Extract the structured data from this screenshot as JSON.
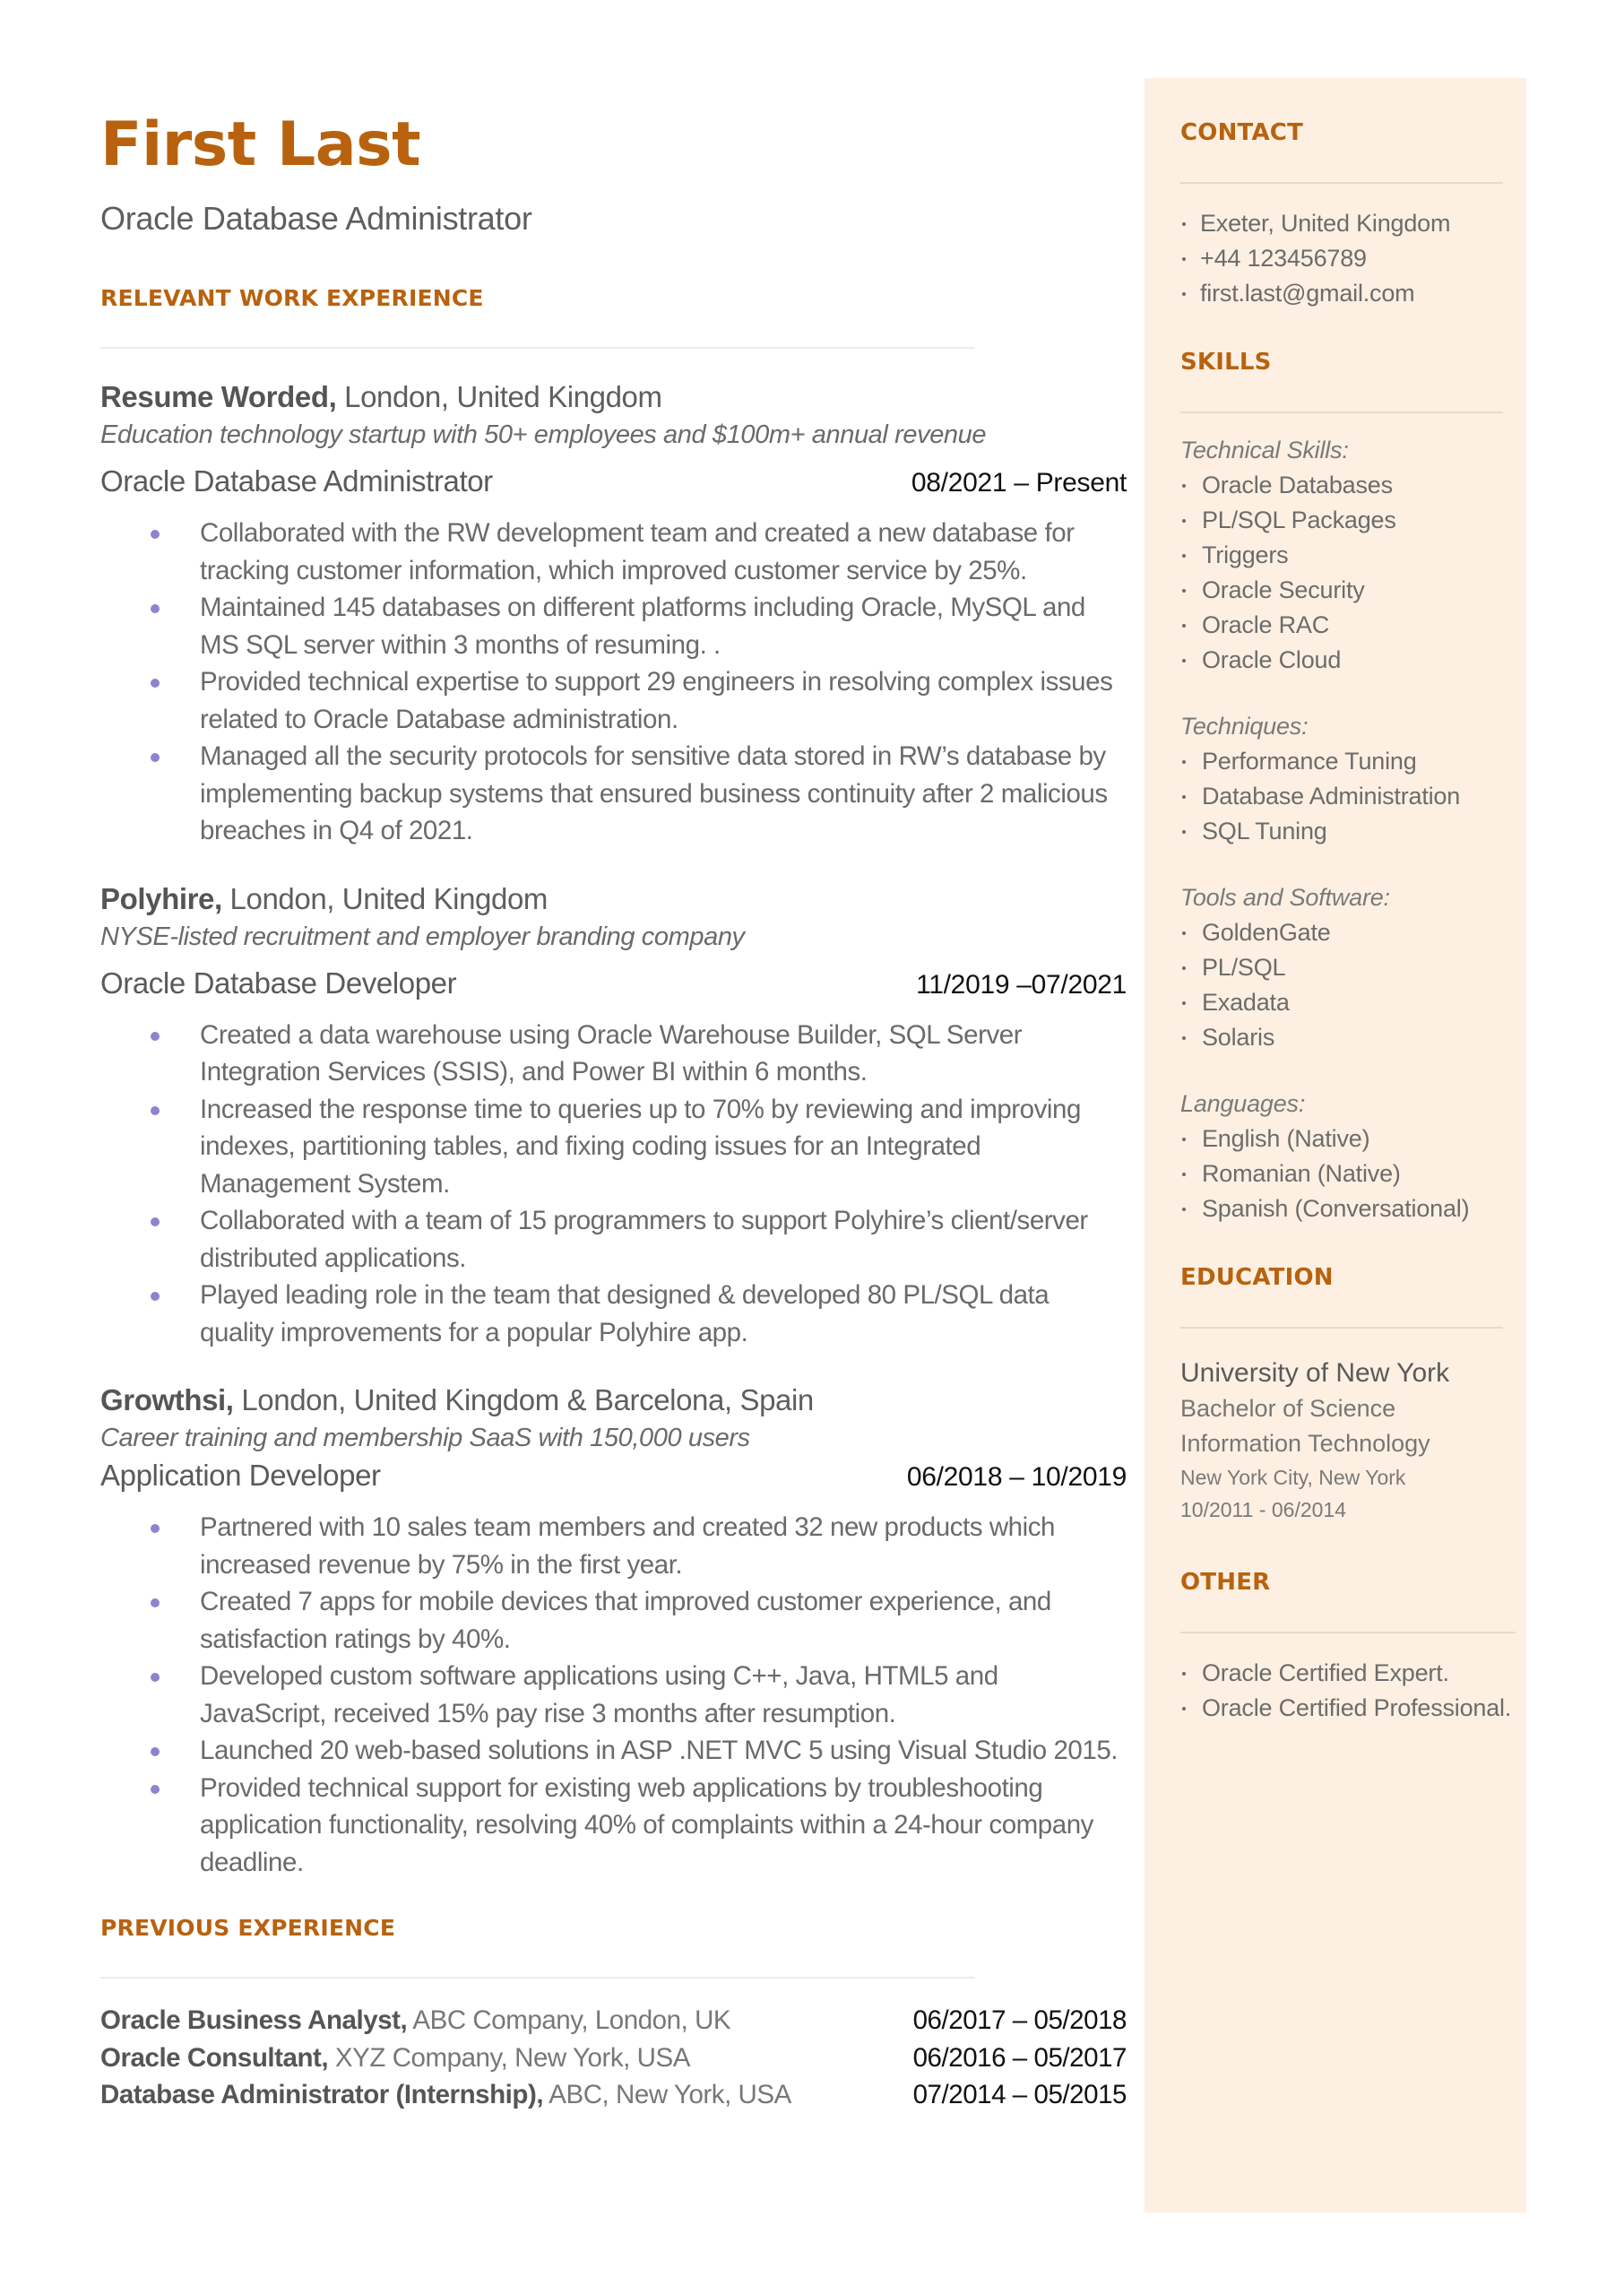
{
  "header": {
    "name": "First Last",
    "title": "Oracle Database Administrator"
  },
  "colors": {
    "accent": "#b8620f",
    "sidebar_bg": "#fdf0e2",
    "bullet": "#8f82cf"
  },
  "work": {
    "heading": "RELEVANT WORK EXPERIENCE",
    "jobs": [
      {
        "company": "Resume Worded,",
        "location": " London, United Kingdom",
        "description": "Education technology startup with 50+ employees and $100m+ annual revenue",
        "role": "Oracle Database Administrator",
        "dates": "08/2021 – Present",
        "bullets": [
          "Collaborated with the RW development team and created a new database for tracking customer information, which improved customer service by 25%.",
          "Maintained 145 databases on different platforms including Oracle, MySQL and MS SQL server within 3 months of resuming. .",
          "Provided technical expertise to support 29 engineers in resolving complex issues related to Oracle Database administration.",
          "Managed all the security protocols for sensitive data stored in RW’s database by implementing backup systems that ensured business continuity after 2 malicious breaches in Q4 of 2021."
        ]
      },
      {
        "company": "Polyhire,",
        "location": " London, United Kingdom",
        "description": "NYSE-listed recruitment and employer branding company",
        "role": "Oracle Database Developer",
        "dates": "11/2019 –07/2021",
        "bullets": [
          "Created a data warehouse using Oracle Warehouse Builder, SQL Server Integration Services (SSIS), and Power BI within 6 months.",
          "Increased the response time to queries up to 70%  by reviewing and improving indexes, partitioning tables, and fixing coding issues for an Integrated Management System.",
          "Collaborated with a team of 15 programmers to support Polyhire’s client/server distributed applications.",
          "Played leading role in the team that designed & developed 80 PL/SQL data quality improvements for a popular Polyhire app."
        ]
      },
      {
        "company": "Growthsi,",
        "location": " London, United Kingdom & Barcelona, Spain",
        "description": "Career training and membership SaaS with 150,000 users",
        "role": "Application Developer",
        "dates": "06/2018 – 10/2019",
        "bullets": [
          "Partnered with 10 sales team members and created 32 new products which increased revenue by 75% in the first year.",
          "Created 7 apps for mobile devices that improved customer experience, and satisfaction ratings by 40%.",
          "Developed custom software applications using C++, Java, HTML5 and JavaScript, received 15% pay rise 3 months after resumption.",
          "Launched 20 web-based solutions in ASP .NET MVC 5 using Visual Studio 2015.",
          "Provided technical support for existing web applications by troubleshooting application functionality, resolving 40% of complaints within a 24-hour company deadline."
        ]
      }
    ]
  },
  "previous": {
    "heading": "PREVIOUS EXPERIENCE",
    "items": [
      {
        "title": "Oracle Business Analyst,",
        "org": " ABC Company, London, UK",
        "dates": "06/2017 – 05/2018"
      },
      {
        "title": "Oracle Consultant,",
        "org": " XYZ Company, New York, USA",
        "dates": "06/2016 – 05/2017"
      },
      {
        "title": "Database Administrator (Internship),",
        "org": " ABC, New York, USA",
        "dates": "07/2014 – 05/2015"
      }
    ]
  },
  "sidebar": {
    "contact": {
      "heading": "CONTACT",
      "items": [
        "Exeter, United Kingdom",
        "+44 123456789",
        "first.last@gmail.com"
      ]
    },
    "skills": {
      "heading": "SKILLS",
      "groups": [
        {
          "label": "Technical Skills:",
          "items": [
            "Oracle Databases",
            "PL/SQL Packages",
            "Triggers",
            "Oracle Security",
            "Oracle RAC",
            "Oracle Cloud"
          ]
        },
        {
          "label": "Techniques:",
          "items": [
            "Performance Tuning",
            "Database Administration",
            "SQL Tuning"
          ]
        },
        {
          "label": "Tools and Software:",
          "items": [
            "GoldenGate",
            "PL/SQL",
            "Exadata",
            "Solaris"
          ]
        },
        {
          "label": "Languages:",
          "items": [
            "English (Native)",
            "Romanian (Native)",
            "Spanish (Conversational)"
          ]
        }
      ]
    },
    "education": {
      "heading": "EDUCATION",
      "school": "University of New York",
      "degree": "Bachelor of Science",
      "field": "Information Technology",
      "location": "New York City, New York",
      "dates": "10/2011 - 06/2014"
    },
    "other": {
      "heading": "OTHER",
      "items": [
        "Oracle Certified Expert.",
        "Oracle Certified Professional."
      ]
    }
  }
}
